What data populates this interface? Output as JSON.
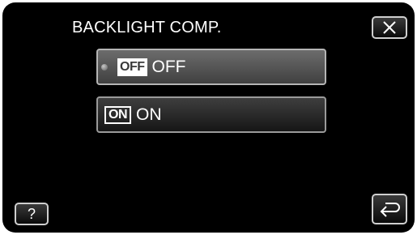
{
  "header": {
    "title": "BACKLIGHT COMP."
  },
  "controls": {
    "close_icon": "close-icon",
    "help_label": "?",
    "back_icon": "return-arrow-icon"
  },
  "options": [
    {
      "badge": "OFF",
      "label": "OFF",
      "selected": true
    },
    {
      "badge": "ON",
      "label": "ON",
      "selected": false
    }
  ],
  "colors": {
    "background": "#000000",
    "selected_button": "#555555",
    "button": "#262626",
    "text": "#ffffff"
  }
}
